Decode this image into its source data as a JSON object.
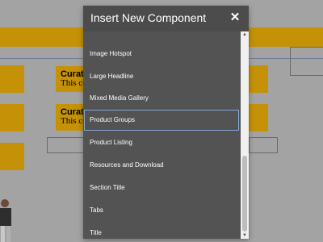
{
  "modal": {
    "title": "Insert New Component",
    "close_glyph": "✕",
    "items": [
      {
        "label": "Image Hotspot"
      },
      {
        "label": "Large Headline"
      },
      {
        "label": "Mixed Media Gallery"
      },
      {
        "label": "Product Groups",
        "selected": true
      },
      {
        "label": "Product Listing"
      },
      {
        "label": "Resources and Download"
      },
      {
        "label": "Section Title"
      },
      {
        "label": "Tabs"
      },
      {
        "label": "Title"
      }
    ],
    "scroll_up_glyph": "▲",
    "scroll_down_glyph": "▼"
  },
  "background": {
    "card1": {
      "title": "Curate",
      "text": "This co"
    },
    "card2": {
      "title": "Curate",
      "text": "This co"
    }
  },
  "colors": {
    "accent_gold": "#c49107",
    "modal_bg": "#535353",
    "selection_border": "#7fa7d6"
  }
}
